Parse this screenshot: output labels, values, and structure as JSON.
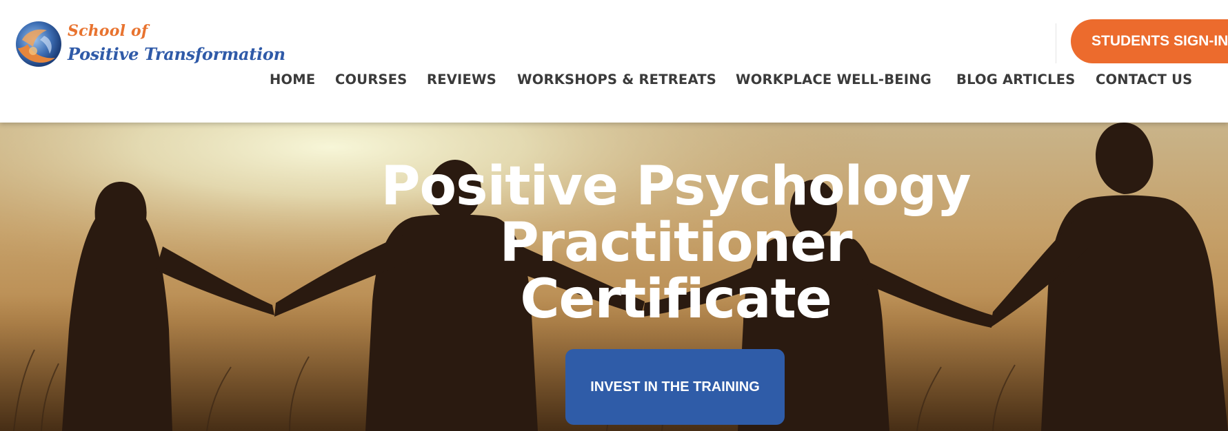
{
  "brand": {
    "line1": "School of",
    "line2": "Positive Transformation",
    "colors": {
      "orange": "#ec6b2d",
      "blue": "#2f5ca8"
    }
  },
  "header": {
    "signin_label": "STUDENTS SIGN-IN"
  },
  "nav": {
    "items": [
      {
        "label": "HOME"
      },
      {
        "label": "COURSES"
      },
      {
        "label": "REVIEWS"
      },
      {
        "label": "WORKSHOPS & RETREATS"
      },
      {
        "label": "WORKPLACE WELL-BEING"
      },
      {
        "label": "BLOG ARTICLES"
      },
      {
        "label": "CONTACT US"
      }
    ]
  },
  "hero": {
    "title_lines": [
      "Positive Psychology",
      "Practitioner",
      "Certificate"
    ],
    "cta_label": "INVEST IN THE TRAINING",
    "image_icon": "people-holding-hands-silhouette"
  }
}
